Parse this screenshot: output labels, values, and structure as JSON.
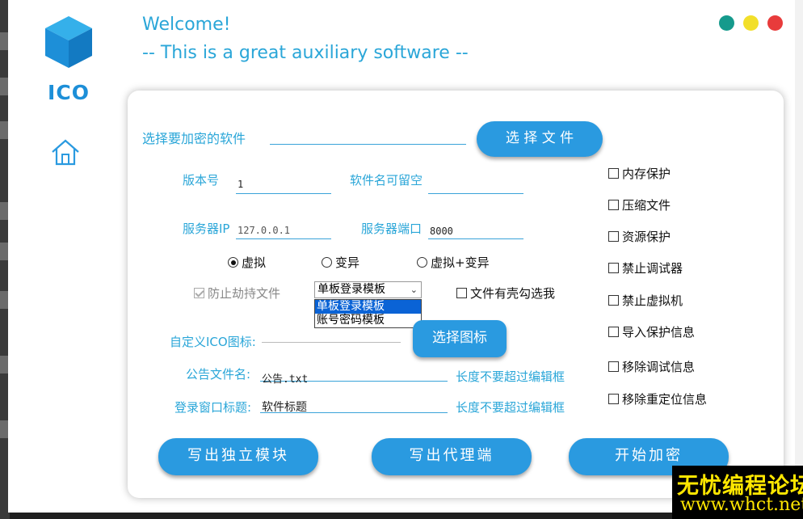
{
  "app": {
    "logo_text": "ICO",
    "welcome": "Welcome!",
    "subtitle": "-- This is a great auxiliary software --"
  },
  "colors": {
    "accent": "#2a9ae0",
    "dot_teal": "#159a8c",
    "dot_yellow": "#f2df2a",
    "dot_red": "#e83b3b"
  },
  "icons": [
    "cube-logo-icon",
    "home-icon",
    "chevron-down-icon"
  ],
  "form": {
    "select_software_label": "选择要加密的软件",
    "select_file_button": "选 择 文 件",
    "version_label": "版本号",
    "version_value": "1",
    "software_name_label": "软件名可留空",
    "server_ip_label": "服务器IP",
    "server_ip_value": "127.0.0.1",
    "server_port_label": "服务器端口",
    "server_port_value": "8000",
    "radio_options": [
      "虚拟",
      "变异",
      "虚拟+变异"
    ],
    "radio_selected": "虚拟",
    "anti_hijack_label": "防止劫持文件",
    "template_selected": "单板登录模板",
    "template_options": [
      "单板登录模板",
      "账号密码模板"
    ],
    "shell_check_label": "文件有壳勾选我",
    "custom_ico_label": "自定义ICO图标:",
    "select_icon_button": "选择图标",
    "notice_file_label": "公告文件名:",
    "notice_file_value": "公告.txt",
    "notice_hint": "长度不要超过编辑框",
    "login_title_label": "登录窗口标题:",
    "login_title_value": "软件标题",
    "login_title_hint": "长度不要超过编辑框"
  },
  "options": [
    "内存保护",
    "压缩文件",
    "资源保护",
    "禁止调试器",
    "禁止虚拟机",
    "导入保护信息",
    "移除调试信息",
    "移除重定位信息"
  ],
  "actions": {
    "write_module": "写出独立模块",
    "write_proxy": "写出代理端",
    "start_encrypt": "开始加密"
  },
  "watermark": {
    "cn": "无忧编程论坛",
    "url": "www.whct.net"
  }
}
